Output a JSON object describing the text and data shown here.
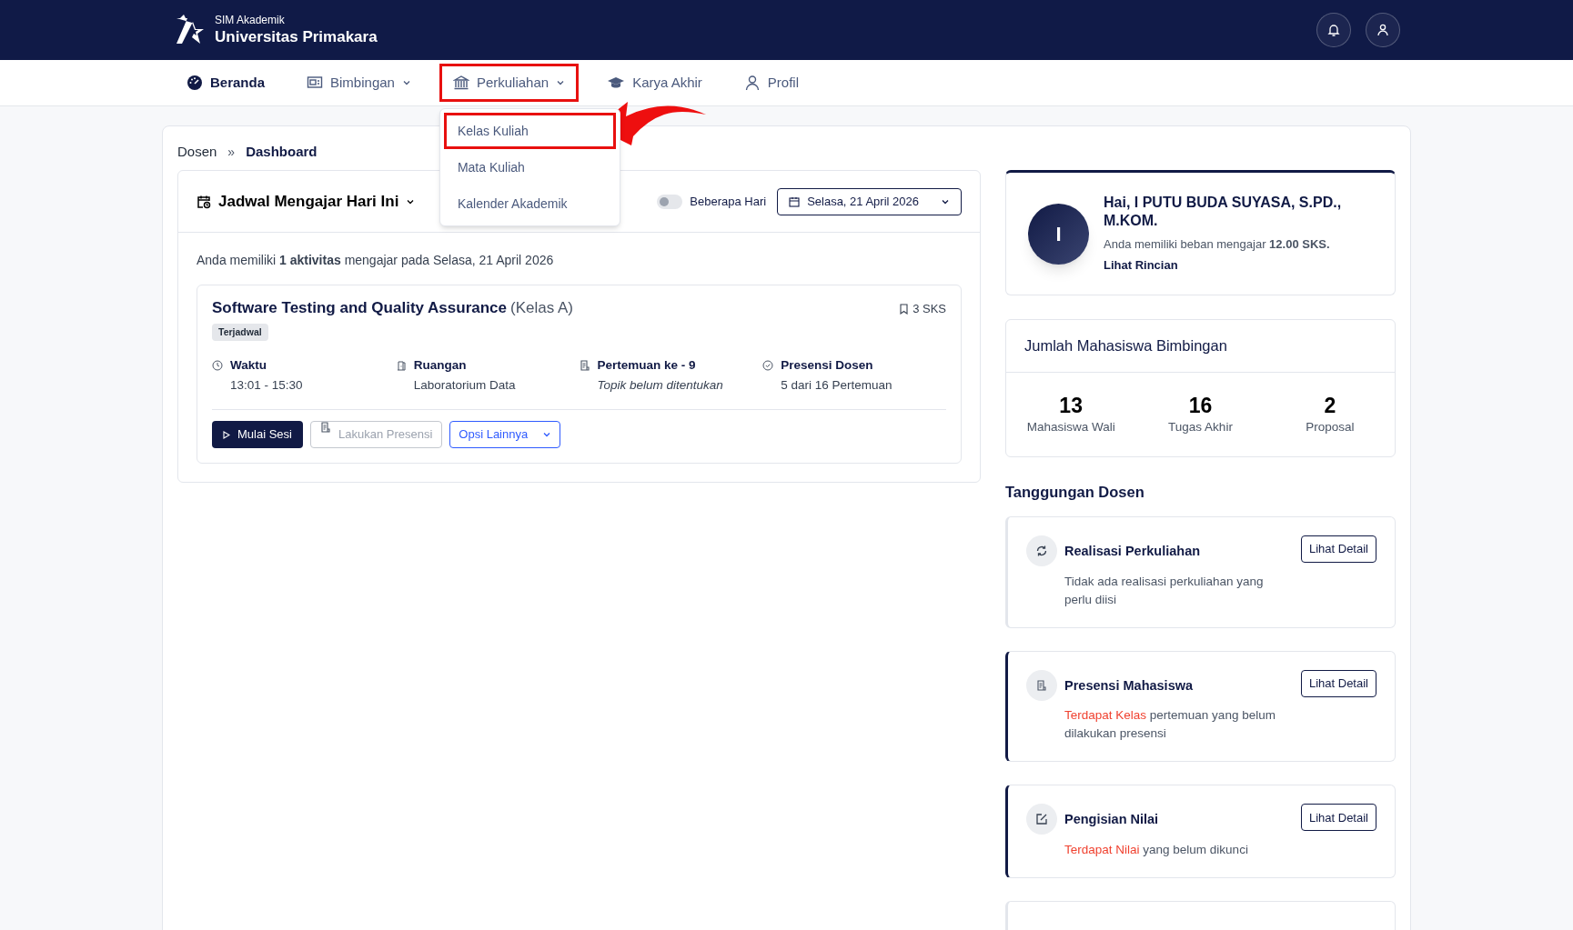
{
  "header": {
    "app_name": "SIM Akademik",
    "university": "Universitas Primakara"
  },
  "nav": [
    {
      "label": "Beranda",
      "selected": true,
      "has_menu": false,
      "highlighted": false
    },
    {
      "label": "Bimbingan",
      "selected": false,
      "has_menu": true,
      "highlighted": false
    },
    {
      "label": "Perkuliahan",
      "selected": false,
      "has_menu": true,
      "highlighted": true,
      "menu": [
        {
          "label": "Kelas Kuliah",
          "highlighted": true
        },
        {
          "label": "Mata Kuliah",
          "highlighted": false
        },
        {
          "label": "Kalender Akademik",
          "highlighted": false
        }
      ]
    },
    {
      "label": "Karya Akhir",
      "selected": false,
      "has_menu": false,
      "highlighted": false
    },
    {
      "label": "Profil",
      "selected": false,
      "has_menu": false,
      "highlighted": false
    }
  ],
  "breadcrumb": {
    "items": [
      "Dosen",
      "Dashboard"
    ],
    "separator": "»"
  },
  "schedule": {
    "title": "Jadwal Mengajar Hari Ini",
    "toggle": {
      "label": "Beberapa Hari",
      "on": false
    },
    "date": "Selasa, 21 April 2026",
    "summary": "Anda memiliki **1 aktivitas** mengajar pada Selasa, 21 April 2026",
    "classes": [
      {
        "course": "Software Testing and Quality Assurance",
        "class_name": "(Kelas A)",
        "status": "Terjadwal",
        "credits": "3 SKS",
        "details": [
          {
            "label": "Waktu",
            "value": "13:01 - 15:30",
            "italic": false
          },
          {
            "label": "Ruangan",
            "value": "Laboratorium Data",
            "italic": false
          },
          {
            "label": "Pertemuan ke - 9",
            "value": "Topik belum ditentukan",
            "italic": true
          },
          {
            "label": "Presensi Dosen",
            "value": "5 dari 16 Pertemuan",
            "italic": false
          }
        ],
        "actions": [
          {
            "label": "Mulai Sesi",
            "kind": "primary"
          },
          {
            "label": "Lakukan Presensi",
            "kind": "disabled"
          },
          {
            "label": "Opsi Lainnya",
            "kind": "dropdown"
          }
        ]
      }
    ]
  },
  "profile": {
    "initial": "I",
    "greeting": "Hai, I PUTU BUDA SUYASA, S.PD., M.KOM.",
    "load": "Anda memiliki beban mengajar **12.00 SKS.**",
    "link": "Lihat Rincian"
  },
  "advisees": {
    "title": "Jumlah Mahasiswa Bimbingan",
    "stats": [
      {
        "value": "13",
        "label": "Mahasiswa Wali"
      },
      {
        "value": "16",
        "label": "Tugas Akhir"
      },
      {
        "value": "2",
        "label": "Proposal"
      }
    ]
  },
  "duties": {
    "title": "Tanggungan Dosen",
    "items": [
      {
        "title": "Realisasi Perkuliahan",
        "text": "Tidak ada realisasi perkuliahan yang perlu diisi",
        "attention": false,
        "button": "Lihat Detail"
      },
      {
        "title": "Presensi Mahasiswa",
        "alert": "Terdapat Kelas",
        "text": "pertemuan yang belum dilakukan presensi",
        "attention": true,
        "button": "Lihat Detail"
      },
      {
        "title": "Pengisian Nilai",
        "alert": "Terdapat Nilai",
        "text": "yang belum dikunci",
        "attention": true,
        "button": "Lihat Detail"
      },
      {
        "attention": false
      }
    ]
  }
}
